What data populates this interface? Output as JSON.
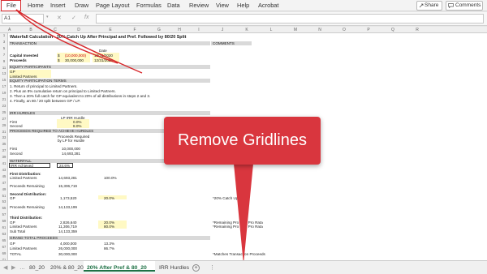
{
  "ribbon": {
    "tabs": [
      "File",
      "Home",
      "Insert",
      "Draw",
      "Page Layout",
      "Formulas",
      "Data",
      "Review",
      "View",
      "Help",
      "Acrobat"
    ],
    "share_label": "Share",
    "comments_label": "Comments"
  },
  "formula_bar": {
    "name_box": "A1",
    "formula": ""
  },
  "grid": {
    "columns": [
      "A",
      "B",
      "C",
      "D",
      "E",
      "F",
      "G",
      "H",
      "I",
      "J",
      "K",
      "L",
      "M",
      "N",
      "O",
      "P",
      "Q",
      "R"
    ],
    "rows": [
      "1",
      "2",
      "3",
      "4",
      "5",
      "6",
      "7",
      "8",
      "9",
      "10",
      "11",
      "12",
      "13",
      "14",
      "15",
      "16",
      "17",
      "18",
      "19",
      "20",
      "21",
      "22",
      "23",
      "24",
      "25",
      "26",
      "27",
      "28",
      "29",
      "30",
      "31",
      "32",
      "33",
      "34",
      "35",
      "36",
      "37",
      "38",
      "39",
      "40",
      "41",
      "42",
      "43",
      "44",
      "45",
      "46",
      "47",
      "48",
      "49",
      "50",
      "51",
      "52",
      "53",
      "54",
      "55",
      "56",
      "57",
      "58",
      "59",
      "60",
      "61",
      "62",
      "63",
      "64",
      "65",
      "66",
      "67",
      "68",
      "69",
      "70",
      "71"
    ]
  },
  "sheet": {
    "title": "Waterfall Calculation - 20% Catch Up After Principal and Pref. Followed by 80/20 Split",
    "transaction": "TRANSACTION",
    "comments": "COMMENTS",
    "date_hdr": "Date",
    "capital_invested": "Capital Invested",
    "capital_dollar": "$",
    "capital_value": "(10,000,000)",
    "capital_date": "12/31/2020",
    "proceeds": "Proceeds",
    "proceeds_dollar": "$",
    "proceeds_value": "30,000,000",
    "proceeds_date": "12/31/2025",
    "equity_participants": "EQUITY PARTICIPANTS",
    "gp": "GP",
    "lp": "Limited Partners",
    "equity_terms": "EQUITY PARTICIPATION TERMS",
    "term1": "1. Return of principal to Limited Partners.",
    "term2": "2. Plus an 8% cumulative return on principal to Limited Partners.",
    "term3": "3. Then a 20% full catch for GP equivalent to 20% of all distributions in steps 2 and 3.",
    "term4": "4. Finally, an 80 / 20 split between GP / LP.",
    "irr_hurdles": "IRR HURDLES",
    "lp_irr_hurdle": "LP IRR Hurdle",
    "first": "First",
    "first_val": "0.0%",
    "second": "Second",
    "second_val": "8.0%",
    "proceeds_required": "PROCEEDS REQUIRED TO ACHIEVE HURDLES",
    "proceeds_req_hdr1": "Proceeds Required",
    "proceeds_req_hdr2": "by LP for Hurdle",
    "pr_first": "First",
    "pr_first_val": "10,000,000",
    "pr_second": "Second",
    "pr_second_val": "14,693,281",
    "waterfall": "WATERFALL",
    "irr_achieved": "IRR Achieved",
    "irr_achieved_val": "24.6%",
    "first_dist": "First Distribution:",
    "fd_lp": "Limited Partners",
    "fd_lp_val": "14,693,281",
    "fd_lp_pct": "100.0%",
    "fd_rem": "Proceeds Remaining",
    "fd_rem_val": "15,306,719",
    "second_dist": "Second Distribution:",
    "sd_gp": "GP",
    "sd_gp_val": "1,173,520",
    "sd_gp_pct": "20.0%",
    "sd_comment": "*20% Catch Up",
    "sd_rem": "Proceeds Remaining",
    "sd_rem_val": "14,133,199",
    "third_dist": "Third Distribution:",
    "td_gp": "GP",
    "td_gp_val": "2,826,640",
    "td_gp_pct": "20.0%",
    "td_gp_comment": "*Remaining Pro     Split Pro Rata",
    "td_lp": "Limited Partners",
    "td_lp_val": "11,306,719",
    "td_lp_pct": "80.0%",
    "td_lp_comment": "*Remaining Pro     Split Pro Rata",
    "td_sub": "Sub Total",
    "td_sub_val": "14,133,359",
    "grand_total": "GRAND TOTAL PROCEEDS",
    "gt_gp": "GP",
    "gt_gp_val": "4,000,000",
    "gt_gp_pct": "13.3%",
    "gt_lp": "Limited Partners",
    "gt_lp_val": "26,000,000",
    "gt_lp_pct": "86.7%",
    "gt_total": "TOTAL",
    "gt_total_val": "30,000,000",
    "gt_comment": "*Matches Transaction Proceeds"
  },
  "sheet_tabs": {
    "tab1": "80_20",
    "tab2": "20% & 80_20",
    "tab3": "20% After Pref & 80_20",
    "tab4": "IRR Hurdles"
  },
  "callout": {
    "text": "Remove Gridlines"
  },
  "colors": {
    "accent": "#d9363e",
    "excel_green": "#1e7145",
    "highlight": "#fff9c4"
  },
  "icons": [
    "share-icon",
    "comments-icon",
    "cancel-icon",
    "enter-icon",
    "fx-icon",
    "add-sheet-icon",
    "ellipsis-icon"
  ]
}
